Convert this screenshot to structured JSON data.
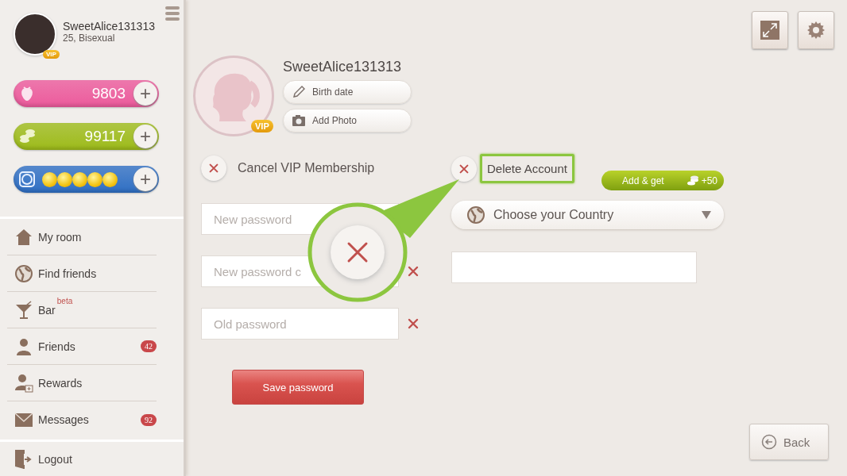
{
  "sidebar": {
    "user": {
      "name": "SweetAlice131313",
      "details": "25, Bisexual",
      "badge": "VIP"
    },
    "currencies": [
      {
        "kind": "strawberries",
        "value": "9803",
        "color": "#ec5a9c",
        "add": "+"
      },
      {
        "kind": "coins",
        "value": "99117",
        "color": "#9dbb1a",
        "add": "+"
      },
      {
        "kind": "tokens",
        "color": "#2f6fc4",
        "add": "+"
      }
    ],
    "menu": [
      {
        "label": "My room"
      },
      {
        "label": "Find friends"
      },
      {
        "label": "Bar",
        "tag": "beta"
      },
      {
        "label": "Friends",
        "count": "42"
      },
      {
        "label": "Rewards"
      },
      {
        "label": "Messages",
        "count": "92"
      }
    ],
    "logout": "Logout"
  },
  "profile": {
    "name": "SweetAlice131313",
    "badge": "VIP",
    "actions": [
      "Birth date",
      "Add Photo"
    ]
  },
  "cancel_vip": "Cancel VIP Membership",
  "delete_account": {
    "label": "Delete Account",
    "highlighted": true
  },
  "bonus": {
    "label": "Add & get",
    "reward": "+50"
  },
  "country": {
    "placeholder": "Choose your Country"
  },
  "passwords": [
    {
      "placeholder": "New password"
    },
    {
      "placeholder": "New password c",
      "clear": true
    },
    {
      "placeholder": "Old password",
      "clear": true
    }
  ],
  "save_button": "Save password",
  "back_button": "Back"
}
